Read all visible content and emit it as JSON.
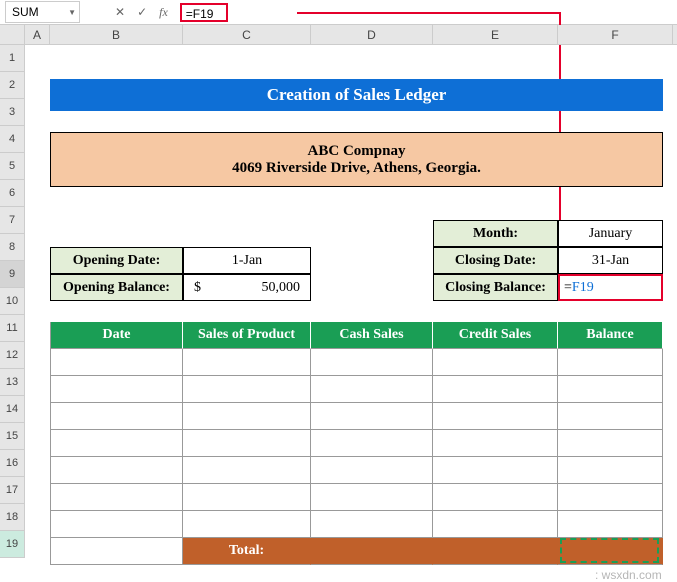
{
  "formulaBar": {
    "nameBox": "SUM",
    "cancel": "✕",
    "confirm": "✓",
    "fx": "fx",
    "formula": "=F19"
  },
  "columns": [
    "A",
    "B",
    "C",
    "D",
    "E",
    "F"
  ],
  "rows": [
    "1",
    "2",
    "3",
    "4",
    "5",
    "6",
    "7",
    "8",
    "9",
    "10",
    "11",
    "12",
    "13",
    "14",
    "15",
    "16",
    "17",
    "18",
    "19"
  ],
  "title": "Creation of Sales Ledger",
  "company": {
    "name": "ABC Compnay",
    "address": "4069 Riverside Drive, Athens, Georgia."
  },
  "labels": {
    "openingDate": "Opening Date:",
    "openingBalance": "Opening Balance:",
    "month": "Month:",
    "closingDate": "Closing Date:",
    "closingBalance": "Closing Balance:"
  },
  "values": {
    "openingDate": "1-Jan",
    "openingBalanceCurrency": "$",
    "openingBalanceAmount": "50,000",
    "month": "January",
    "closingDate": "31-Jan",
    "closingBalanceEq": "=",
    "closingBalanceRef": "F19"
  },
  "table": {
    "headers": [
      "Date",
      "Sales of Product",
      "Cash Sales",
      "Credit Sales",
      "Balance"
    ],
    "totalLabel": "Total:"
  },
  "watermark": ": wsxdn.com"
}
